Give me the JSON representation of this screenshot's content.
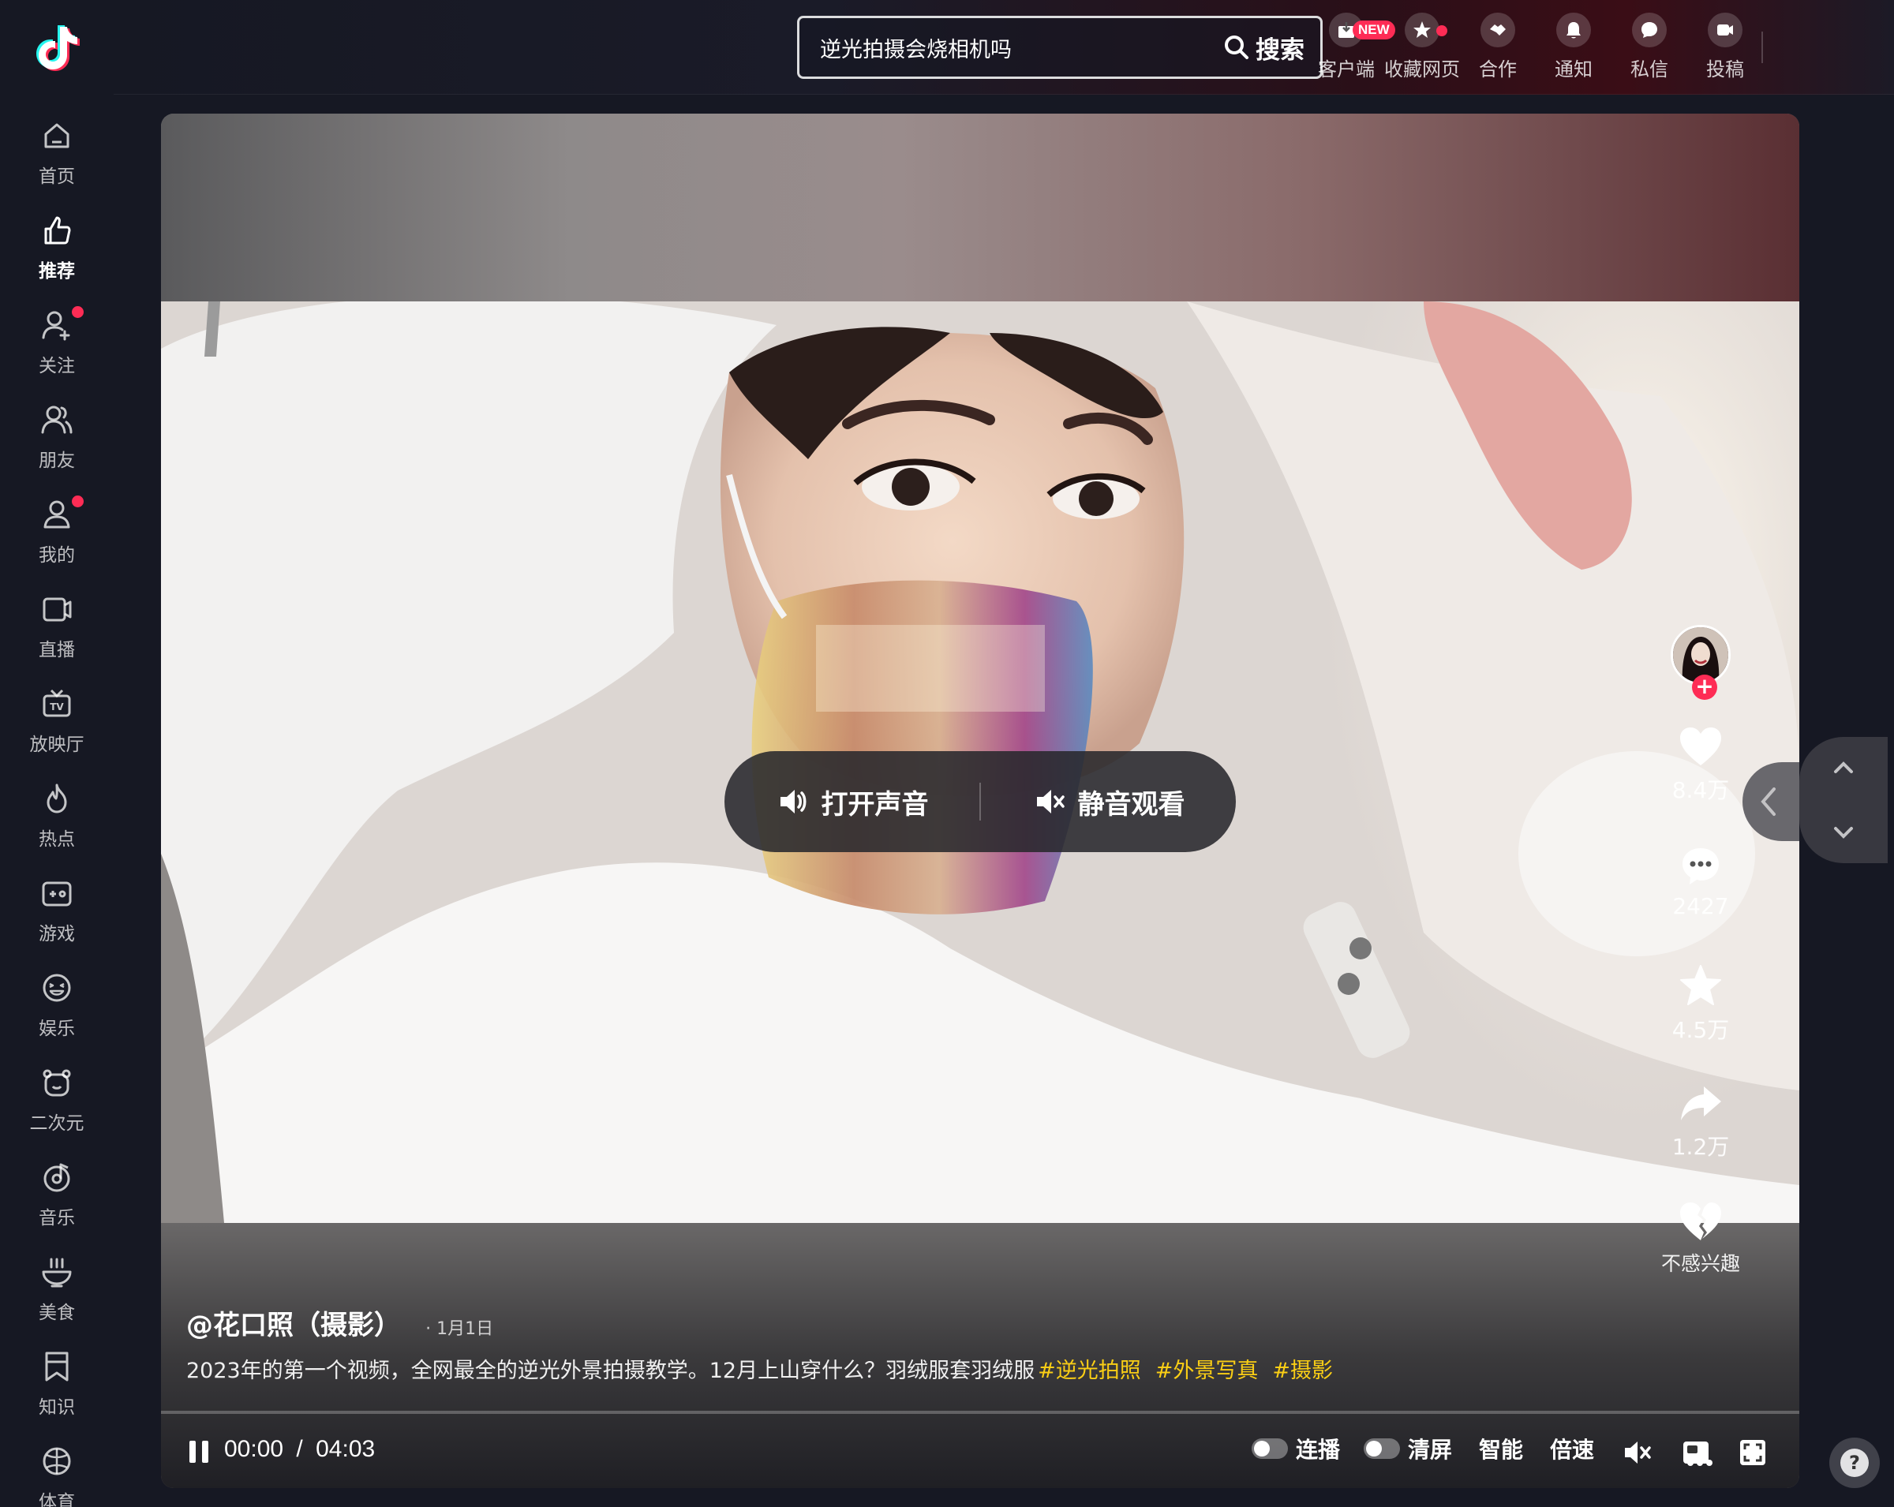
{
  "sidebar": {
    "items": [
      {
        "label": "首页",
        "icon": "home-icon"
      },
      {
        "label": "推荐",
        "icon": "thumbs-up-icon",
        "active": true
      },
      {
        "label": "关注",
        "icon": "add-user-icon",
        "dot": true
      },
      {
        "label": "朋友",
        "icon": "friends-icon"
      },
      {
        "label": "我的",
        "icon": "user-icon",
        "dot": true
      },
      {
        "label": "直播",
        "icon": "live-icon"
      },
      {
        "label": "放映厅",
        "icon": "tv-icon"
      },
      {
        "label": "热点",
        "icon": "flame-icon"
      },
      {
        "label": "游戏",
        "icon": "gamepad-icon"
      },
      {
        "label": "娱乐",
        "icon": "smile-icon"
      },
      {
        "label": "二次元",
        "icon": "bear-icon"
      },
      {
        "label": "音乐",
        "icon": "music-icon"
      },
      {
        "label": "美食",
        "icon": "bowl-icon"
      },
      {
        "label": "知识",
        "icon": "bookmark-icon"
      },
      {
        "label": "体育",
        "icon": "ball-icon"
      }
    ]
  },
  "header": {
    "search_value": "逆光拍摄会烧相机吗",
    "search_button": "搜索",
    "items": [
      {
        "label": "客户端",
        "icon": "download-icon",
        "badge": "NEW"
      },
      {
        "label": "收藏网页",
        "icon": "star-icon",
        "dot": true
      },
      {
        "label": "合作",
        "icon": "handshake-icon"
      },
      {
        "label": "通知",
        "icon": "bell-icon"
      },
      {
        "label": "私信",
        "icon": "message-icon"
      },
      {
        "label": "投稿",
        "icon": "upload-video-icon"
      }
    ]
  },
  "overlay": {
    "sound_on": "打开声音",
    "sound_off": "静音观看"
  },
  "actions": {
    "like": "8.4万",
    "comment": "2427",
    "favorite": "4.5万",
    "share": "1.2万",
    "not_interested": "不感兴趣"
  },
  "video": {
    "author": "@花口照（摄影）",
    "date": "· 1月1日",
    "description": "2023年的第一个视频，全网最全的逆光外景拍摄教学。12月上山穿什么？羽绒服套羽绒服",
    "tags": [
      "#逆光拍照",
      "#外景写真",
      "#摄影"
    ],
    "progress": 0.0
  },
  "controls": {
    "current_time": "00:00",
    "separator": "/",
    "duration": "04:03",
    "autoplay": "连播",
    "clear_screen": "清屏",
    "smart": "智能",
    "speed": "倍速"
  },
  "colors": {
    "background": "#161823",
    "accent": "#fe2c55",
    "tag": "#face15"
  }
}
